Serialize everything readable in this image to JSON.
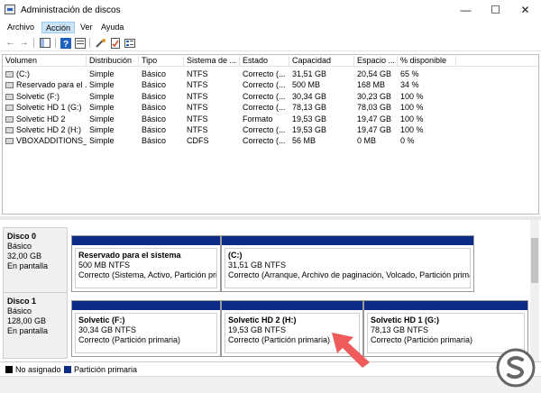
{
  "window": {
    "title": "Administración de discos"
  },
  "menu": [
    {
      "label": "Archivo",
      "active": false
    },
    {
      "label": "Acción",
      "active": true
    },
    {
      "label": "Ver",
      "active": false
    },
    {
      "label": "Ayuda",
      "active": false
    }
  ],
  "table": {
    "columns": [
      "Volumen",
      "Distribución",
      "Tipo",
      "Sistema de ...",
      "Estado",
      "Capacidad",
      "Espacio ...",
      "% disponible"
    ],
    "rows": [
      [
        "(C:)",
        "Simple",
        "Básico",
        "NTFS",
        "Correcto (...",
        "31,51 GB",
        "20,54 GB",
        "65 %"
      ],
      [
        "Reservado para el ...",
        "Simple",
        "Básico",
        "NTFS",
        "Correcto (...",
        "500 MB",
        "168 MB",
        "34 %"
      ],
      [
        "Solvetic (F:)",
        "Simple",
        "Básico",
        "NTFS",
        "Correcto (...",
        "30,34 GB",
        "30,23 GB",
        "100 %"
      ],
      [
        "Solvetic HD 1 (G:)",
        "Simple",
        "Básico",
        "NTFS",
        "Correcto (...",
        "78,13 GB",
        "78,03 GB",
        "100 %"
      ],
      [
        "Solvetic HD 2",
        "Simple",
        "Básico",
        "NTFS",
        "Formato",
        "19,53 GB",
        "19,47 GB",
        "100 %"
      ],
      [
        "Solvetic HD 2 (H:)",
        "Simple",
        "Básico",
        "NTFS",
        "Correcto (...",
        "19,53 GB",
        "19,47 GB",
        "100 %"
      ],
      [
        "VBOXADDITIONS_...",
        "Simple",
        "Básico",
        "CDFS",
        "Correcto (...",
        "56 MB",
        "0 MB",
        "0 %"
      ]
    ]
  },
  "disks": [
    {
      "name": "Disco 0",
      "type": "Básico",
      "size": "32,00 GB",
      "status": "En pantalla",
      "partitions": [
        {
          "name": "Reservado para el sistema",
          "size": "500 MB NTFS",
          "status": "Correcto (Sistema, Activo, Partición prim"
        },
        {
          "name": "(C:)",
          "size": "31,51 GB NTFS",
          "status": "Correcto (Arranque, Archivo de paginación, Volcado, Partición prima"
        }
      ]
    },
    {
      "name": "Disco 1",
      "type": "Básico",
      "size": "128,00 GB",
      "status": "En pantalla",
      "partitions": [
        {
          "name": "Solvetic  (F:)",
          "size": "30,34 GB NTFS",
          "status": "Correcto (Partición primaria)"
        },
        {
          "name": "Solvetic HD 2  (H:)",
          "size": "19,53 GB NTFS",
          "status": "Correcto (Partición primaria)"
        },
        {
          "name": "Solvetic HD 1  (G:)",
          "size": "78,13 GB NTFS",
          "status": "Correcto (Partición primaria)"
        }
      ]
    }
  ],
  "legend": [
    {
      "label": "No asignado",
      "color": "#000000"
    },
    {
      "label": "Partición primaria",
      "color": "#0b2d86"
    }
  ],
  "colors": {
    "primary_partition": "#0b2d86",
    "highlight_arrow": "#ef5a5a",
    "menu_active": "#cce4f7"
  }
}
